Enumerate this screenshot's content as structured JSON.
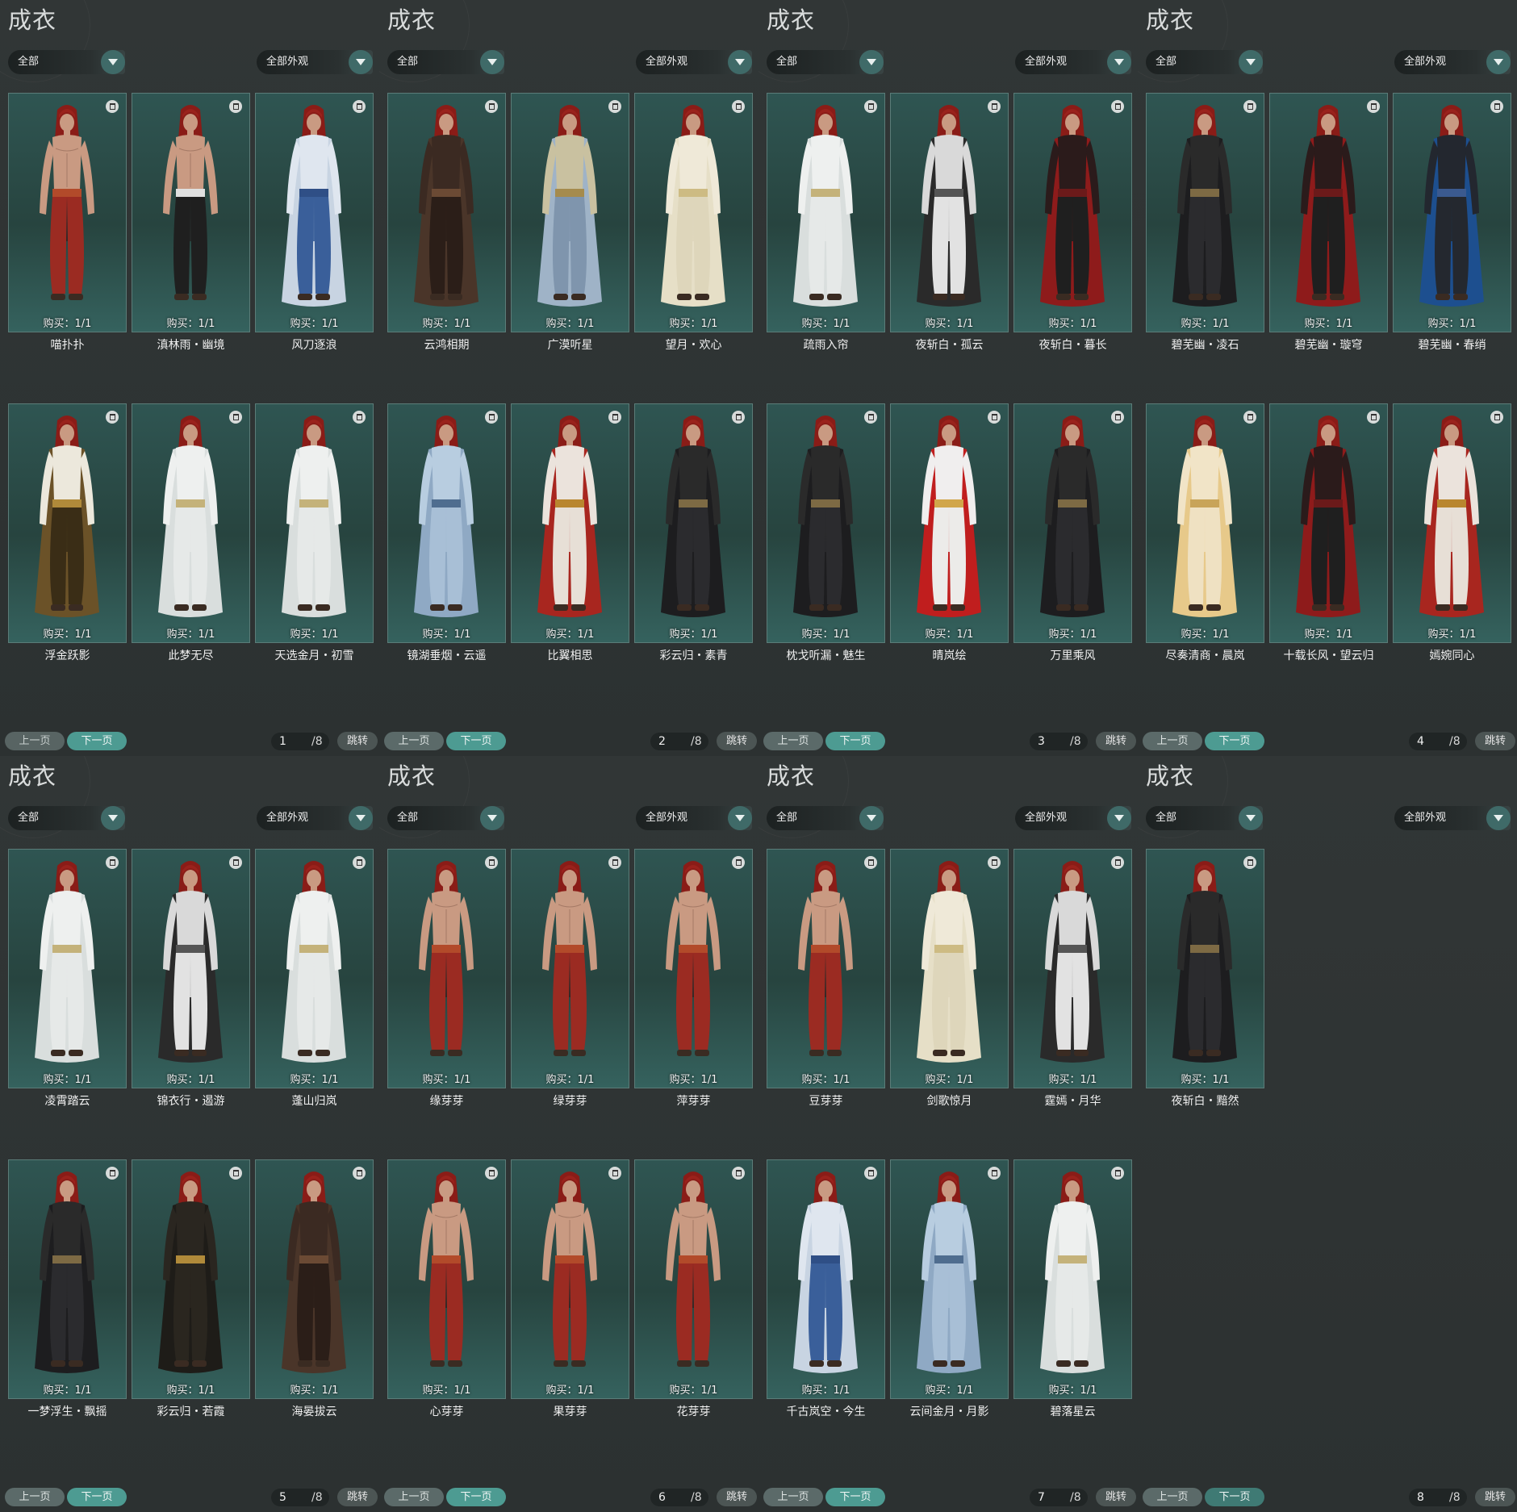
{
  "colors": {
    "background": "#2d3232",
    "card": "#2f5552",
    "accent": "#4d9b92"
  },
  "icons": {
    "trash": "trash-icon",
    "dropdown": "chevron-down-icon"
  },
  "pages": [
    {
      "title": "成衣",
      "filter_left": "全部",
      "filter_right": "全部外观",
      "prev": "上一页",
      "next": "下一页",
      "page": "1",
      "total": "/8",
      "jump": "跳转",
      "items": [
        {
          "buy": "购买：1/1",
          "name": "喵扑扑",
          "palette": "bare-red"
        },
        {
          "buy": "购买：1/1",
          "name": "滇林雨・幽境",
          "palette": "bare-black"
        },
        {
          "buy": "购买：1/1",
          "name": "风刀逐浪",
          "palette": "white-blue"
        },
        {
          "buy": "购买：1/1",
          "name": "浮金跃影",
          "palette": "white-gold"
        },
        {
          "buy": "购买：1/1",
          "name": "此梦无尽",
          "palette": "white"
        },
        {
          "buy": "购买：1/1",
          "name": "天选金月・初雪",
          "palette": "white"
        }
      ]
    },
    {
      "title": "成衣",
      "filter_left": "全部",
      "filter_right": "全部外观",
      "prev": "上一页",
      "next": "下一页",
      "page": "2",
      "total": "/8",
      "jump": "跳转",
      "items": [
        {
          "buy": "购买：1/1",
          "name": "云鸿相期",
          "palette": "dark-brown"
        },
        {
          "buy": "购买：1/1",
          "name": "广漠听星",
          "palette": "blue-gold"
        },
        {
          "buy": "购买：1/1",
          "name": "望月・欢心",
          "palette": "cream"
        },
        {
          "buy": "购买：1/1",
          "name": "镜湖垂烟・云遥",
          "palette": "light-blue"
        },
        {
          "buy": "购买：1/1",
          "name": "比翼相思",
          "palette": "red-white"
        },
        {
          "buy": "购买：1/1",
          "name": "彩云归・素青",
          "palette": "black"
        }
      ]
    },
    {
      "title": "成衣",
      "filter_left": "全部",
      "filter_right": "全部外观",
      "prev": "上一页",
      "next": "下一页",
      "page": "3",
      "total": "/8",
      "jump": "跳转",
      "items": [
        {
          "buy": "购买：1/1",
          "name": "疏雨入帘",
          "palette": "white"
        },
        {
          "buy": "购买：1/1",
          "name": "夜斩白・孤云",
          "palette": "black-white"
        },
        {
          "buy": "购买：1/1",
          "name": "夜斩白・暮长",
          "palette": "red-black"
        },
        {
          "buy": "购买：1/1",
          "name": "枕戈听漏・魅生",
          "palette": "black"
        },
        {
          "buy": "购买：1/1",
          "name": "晴岚绘",
          "palette": "white-red"
        },
        {
          "buy": "购买：1/1",
          "name": "万里乘风",
          "palette": "black"
        }
      ]
    },
    {
      "title": "成衣",
      "filter_left": "全部",
      "filter_right": "全部外观",
      "prev": "上一页",
      "next": "下一页",
      "page": "4",
      "total": "/8",
      "jump": "跳转",
      "items": [
        {
          "buy": "购买：1/1",
          "name": "碧芜幽・凌石",
          "palette": "black"
        },
        {
          "buy": "购买：1/1",
          "name": "碧芜幽・璇穹",
          "palette": "red-black"
        },
        {
          "buy": "购买：1/1",
          "name": "碧芜幽・春绡",
          "palette": "blue-black"
        },
        {
          "buy": "购买：1/1",
          "name": "尽奏清商・晨岚",
          "palette": "cream-gold"
        },
        {
          "buy": "购买：1/1",
          "name": "十载长风・望云归",
          "palette": "red-black"
        },
        {
          "buy": "购买：1/1",
          "name": "嫣婉同心",
          "palette": "red-white"
        }
      ]
    },
    {
      "title": "成衣",
      "filter_left": "全部",
      "filter_right": "全部外观",
      "prev": "上一页",
      "next": "下一页",
      "page": "5",
      "total": "/8",
      "jump": "跳转",
      "items": [
        {
          "buy": "购买：1/1",
          "name": "凌霄踏云",
          "palette": "white"
        },
        {
          "buy": "购买：1/1",
          "name": "锦衣行・遏游",
          "palette": "black-white"
        },
        {
          "buy": "购买：1/1",
          "name": "蓬山归岚",
          "palette": "white"
        },
        {
          "buy": "购买：1/1",
          "name": "一梦浮生・飘摇",
          "palette": "black"
        },
        {
          "buy": "购买：1/1",
          "name": "彩云归・若霞",
          "palette": "black-gold"
        },
        {
          "buy": "购买：1/1",
          "name": "海晏拔云",
          "palette": "dark-brown"
        }
      ]
    },
    {
      "title": "成衣",
      "filter_left": "全部",
      "filter_right": "全部外观",
      "prev": "上一页",
      "next": "下一页",
      "page": "6",
      "total": "/8",
      "jump": "跳转",
      "items": [
        {
          "buy": "购买：1/1",
          "name": "缘芽芽",
          "palette": "bare-red"
        },
        {
          "buy": "购买：1/1",
          "name": "绿芽芽",
          "palette": "bare-red"
        },
        {
          "buy": "购买：1/1",
          "name": "萍芽芽",
          "palette": "bare-red"
        },
        {
          "buy": "购买：1/1",
          "name": "心芽芽",
          "palette": "bare-red"
        },
        {
          "buy": "购买：1/1",
          "name": "果芽芽",
          "palette": "bare-red"
        },
        {
          "buy": "购买：1/1",
          "name": "花芽芽",
          "palette": "bare-red"
        }
      ]
    },
    {
      "title": "成衣",
      "filter_left": "全部",
      "filter_right": "全部外观",
      "prev": "上一页",
      "next": "下一页",
      "page": "7",
      "total": "/8",
      "jump": "跳转",
      "items": [
        {
          "buy": "购买：1/1",
          "name": "豆芽芽",
          "palette": "bare-red"
        },
        {
          "buy": "购买：1/1",
          "name": "剑歌惊月",
          "palette": "cream"
        },
        {
          "buy": "购买：1/1",
          "name": "霆嫣・月华",
          "palette": "black-white"
        },
        {
          "buy": "购买：1/1",
          "name": "千古岚空・今生",
          "palette": "white-blue"
        },
        {
          "buy": "购买：1/1",
          "name": "云间金月・月影",
          "palette": "light-blue"
        },
        {
          "buy": "购买：1/1",
          "name": "碧落星云",
          "palette": "white"
        }
      ]
    },
    {
      "title": "成衣",
      "filter_left": "全部",
      "filter_right": "全部外观",
      "prev": "上一页",
      "next": "下一页",
      "page": "8",
      "total": "/8",
      "jump": "跳转",
      "items": [
        {
          "buy": "购买：1/1",
          "name": "夜斩白・黯然",
          "palette": "black"
        }
      ]
    }
  ]
}
